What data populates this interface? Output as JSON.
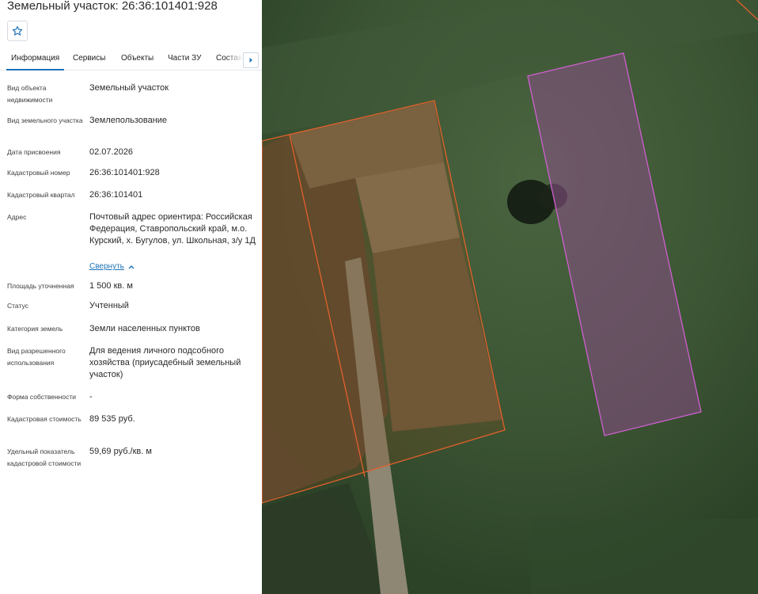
{
  "header": {
    "title": "Земельный участок: 26:36:101401:928",
    "favorite_icon": "star-icon"
  },
  "tabs": [
    {
      "label": "Информация",
      "active": true
    },
    {
      "label": "Сервисы",
      "active": false
    },
    {
      "label": "Объекты",
      "active": false
    },
    {
      "label": "Части ЗУ",
      "active": false
    },
    {
      "label": "Состав",
      "active": false
    }
  ],
  "tab_scroll_icon": "chevron-right-icon",
  "info": {
    "object_type": {
      "label": "Вид объекта недвижимости",
      "value": "Земельный участок"
    },
    "land_type": {
      "label": "Вид земельного участка",
      "value": "Землепользование"
    },
    "assign_date": {
      "label": "Дата присвоения",
      "value": "02.07.2026"
    },
    "cadastral_number": {
      "label": "Кадастровый номер",
      "value": "26:36:101401:928"
    },
    "cadastral_quarter": {
      "label": "Кадастровый квартал",
      "value": "26:36:101401"
    },
    "address": {
      "label": "Адрес",
      "value": "Почтовый адрес ориентира: Российская Федерация, Ставропольский край, м.о. Курский, х. Бугулов, ул. Школьная, з/у 1Д",
      "collapse_link": "Свернуть"
    },
    "area": {
      "label": "Площадь уточненная",
      "value": "1 500 кв. м"
    },
    "status": {
      "label": "Статус",
      "value": "Учтенный"
    },
    "land_category": {
      "label": "Категория земель",
      "value": "Земли населенных пунктов"
    },
    "permitted_use": {
      "label": "Вид разрешенного использования",
      "value": "Для ведения личного подсобного хозяйства (приусадебный земельный участок)"
    },
    "ownership": {
      "label": "Форма собственности",
      "value": "-"
    },
    "cadastral_value": {
      "label": "Кадастровая стоимость",
      "value": "89 535 руб."
    },
    "specific_value": {
      "label": "Удельный показатель кадастровой стоимости",
      "value": "59,69 руб./кв. м"
    }
  },
  "colors": {
    "accent": "#1f73b7",
    "parcel_outline_orange": "#e2602c",
    "parcel_fill_pink": "#b04ab0"
  }
}
